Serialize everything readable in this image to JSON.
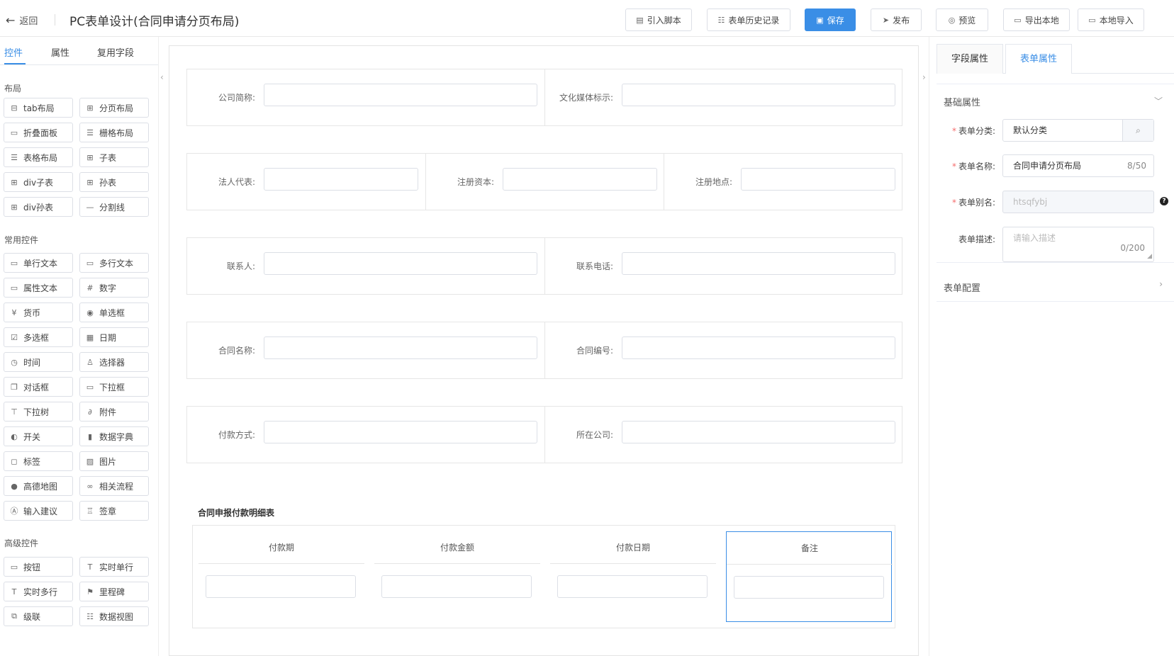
{
  "header": {
    "back_label": "返回",
    "title": "PC表单设计(合同申请分页布局)",
    "buttons": {
      "import_script": "引入脚本",
      "history": "表单历史记录",
      "save": "保存",
      "publish": "发布",
      "preview": "预览",
      "export_local": "导出本地",
      "import_local": "本地导入"
    },
    "accent_color": "#3a8ee6"
  },
  "left_panel": {
    "tabs": [
      "控件",
      "属性",
      "复用字段"
    ],
    "sections": {
      "layout": "布局",
      "common": "常用控件",
      "advanced": "高级控件"
    },
    "layout_items": [
      "tab布局",
      "分页布局",
      "折叠面板",
      "栅格布局",
      "表格布局",
      "子表",
      "div子表",
      "孙表",
      "div孙表",
      "分割线"
    ],
    "common_items": [
      "单行文本",
      "多行文本",
      "属性文本",
      "数字",
      "货币",
      "单选框",
      "多选框",
      "日期",
      "时间",
      "选择器",
      "对话框",
      "下拉框",
      "下拉树",
      "附件",
      "开关",
      "数据字典",
      "标签",
      "图片",
      "高德地图",
      "相关流程",
      "输入建议",
      "签章"
    ],
    "advanced_items": [
      "按钮",
      "实时单行",
      "实时多行",
      "里程碑",
      "级联",
      "数据视图"
    ]
  },
  "form": {
    "row1": [
      "公司简称:",
      "文化媒体标示:"
    ],
    "row2": [
      "法人代表:",
      "注册资本:",
      "注册地点:"
    ],
    "row3": [
      "联系人:",
      "联系电话:"
    ],
    "row4": [
      "合同名称:",
      "合同编号:"
    ],
    "row5": [
      "付款方式:",
      "所在公司:"
    ],
    "subtable_title": "合同申报付款明细表",
    "subtable_cols": [
      "付款期",
      "付款金额",
      "付款日期",
      "备注"
    ]
  },
  "right_panel": {
    "tabs": [
      "字段属性",
      "表单属性"
    ],
    "basic_section": "基础属性",
    "category_label": "表单分类:",
    "category_value": "默认分类",
    "name_label": "表单名称:",
    "name_value": "合同申请分页布局",
    "name_count": "8/50",
    "alias_label": "表单别名:",
    "alias_value": "htsqfybj",
    "desc_label": "表单描述:",
    "desc_placeholder": "请输入描述",
    "desc_count": "0/200",
    "config_section": "表单配置"
  }
}
